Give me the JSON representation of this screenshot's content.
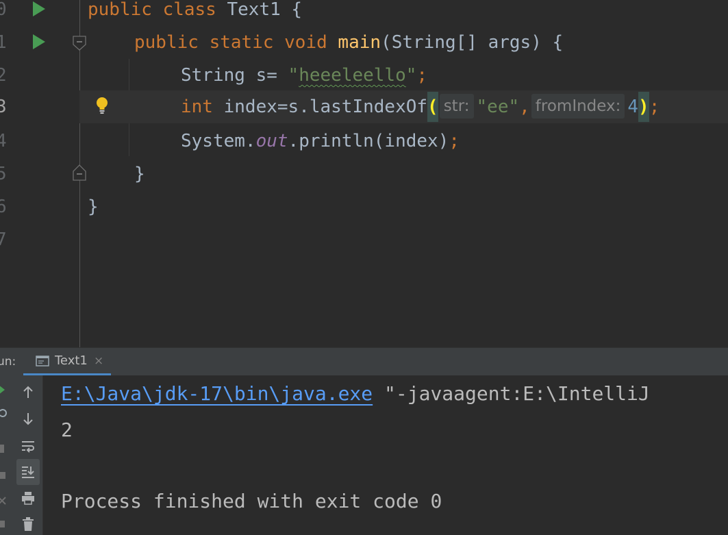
{
  "editor": {
    "lines": [
      {
        "number": "0"
      },
      {
        "number": "1"
      },
      {
        "number": "2"
      },
      {
        "number": "3"
      },
      {
        "number": "4"
      },
      {
        "number": "5"
      },
      {
        "number": "6"
      },
      {
        "number": "7"
      }
    ],
    "code": {
      "l0_kw": "public class",
      "l0_rest": " Text1 {",
      "l1_kw": "public static void",
      "l1_fn": "main",
      "l1_rest": "(String[] args) {",
      "l2_type": "String s= ",
      "l2_str_open": "\"",
      "l2_str_word": "heeeleello",
      "l2_str_close": "\"",
      "l2_semi": ";",
      "l3_kw": "int",
      "l3_rest": " index=s.lastIndexOf",
      "l3_paren_open": "(",
      "l3_hint1": "str:",
      "l3_arg1": "\"ee\"",
      "l3_comma": ",",
      "l3_hint2": "fromIndex:",
      "l3_arg2": "4",
      "l3_paren_close": ")",
      "l3_semi": ";",
      "l4_a": "System.",
      "l4_field": "out",
      "l4_b": ".println(index)",
      "l4_semi": ";",
      "l5": "}",
      "l6": "}"
    },
    "colors": {
      "keyword": "#cc7832",
      "method": "#ffc66d",
      "string": "#6a8759",
      "number": "#6897bb",
      "field": "#9876aa",
      "text": "#a9b7c6"
    }
  },
  "run_panel": {
    "label": "un:",
    "tab_label": "Text1",
    "tab_close": "×",
    "output": {
      "java_path": "E:\\Java\\jdk-17\\bin\\java.exe",
      "java_args": " \"-javaagent:E:\\IntelliJ",
      "result": "2",
      "finish": "Process finished with exit code 0"
    }
  }
}
